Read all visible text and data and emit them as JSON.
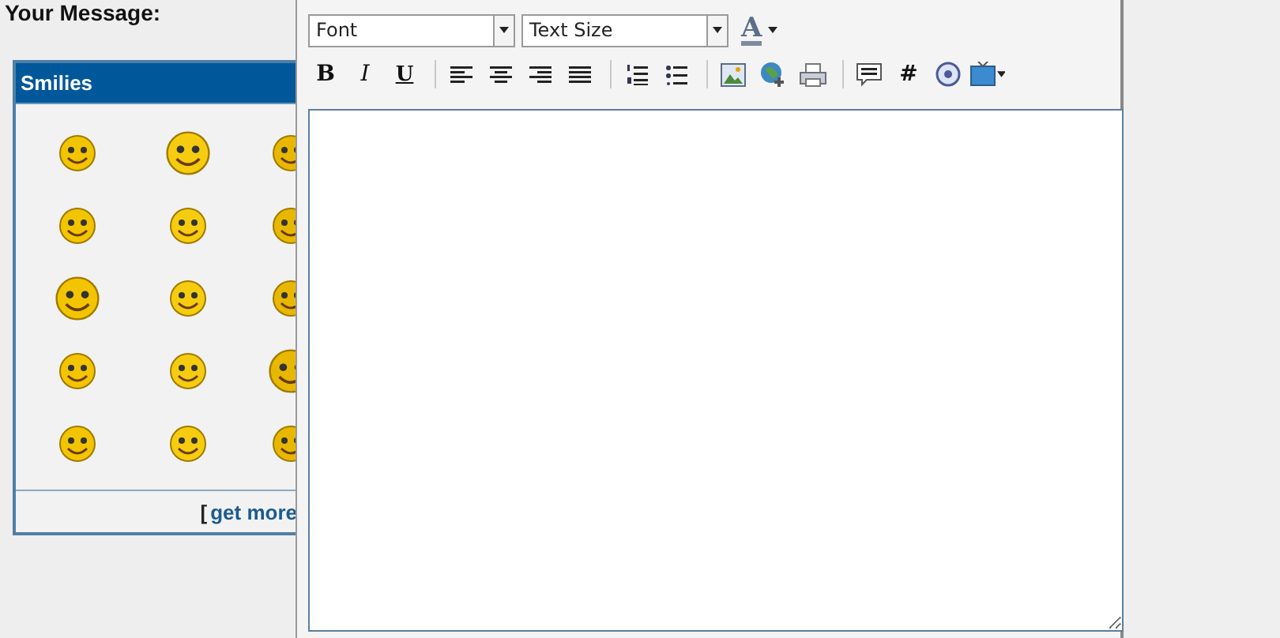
{
  "message_label": "Your Message:",
  "smilies": {
    "title": "Smilies",
    "bracket": "[",
    "link": "get more"
  },
  "editor": {
    "font_select": {
      "value": "Font"
    },
    "size_select": {
      "value": "Text Size"
    },
    "color_button": {
      "label": "A"
    },
    "toolbar_groups": [
      [
        {
          "kind": "bold",
          "label": "B"
        },
        {
          "kind": "italic",
          "label": "I"
        },
        {
          "kind": "underline",
          "label": "U"
        }
      ],
      [
        {
          "kind": "alignleft"
        },
        {
          "kind": "aligncenter"
        },
        {
          "kind": "alignright"
        },
        {
          "kind": "justify"
        }
      ],
      [
        {
          "kind": "numbered"
        },
        {
          "kind": "bulleted"
        }
      ],
      [
        {
          "kind": "image"
        },
        {
          "kind": "globe"
        },
        {
          "kind": "printer"
        }
      ],
      [
        {
          "kind": "comment"
        },
        {
          "kind": "hash",
          "label": "#"
        },
        {
          "kind": "disc"
        },
        {
          "kind": "screen"
        }
      ]
    ]
  }
}
